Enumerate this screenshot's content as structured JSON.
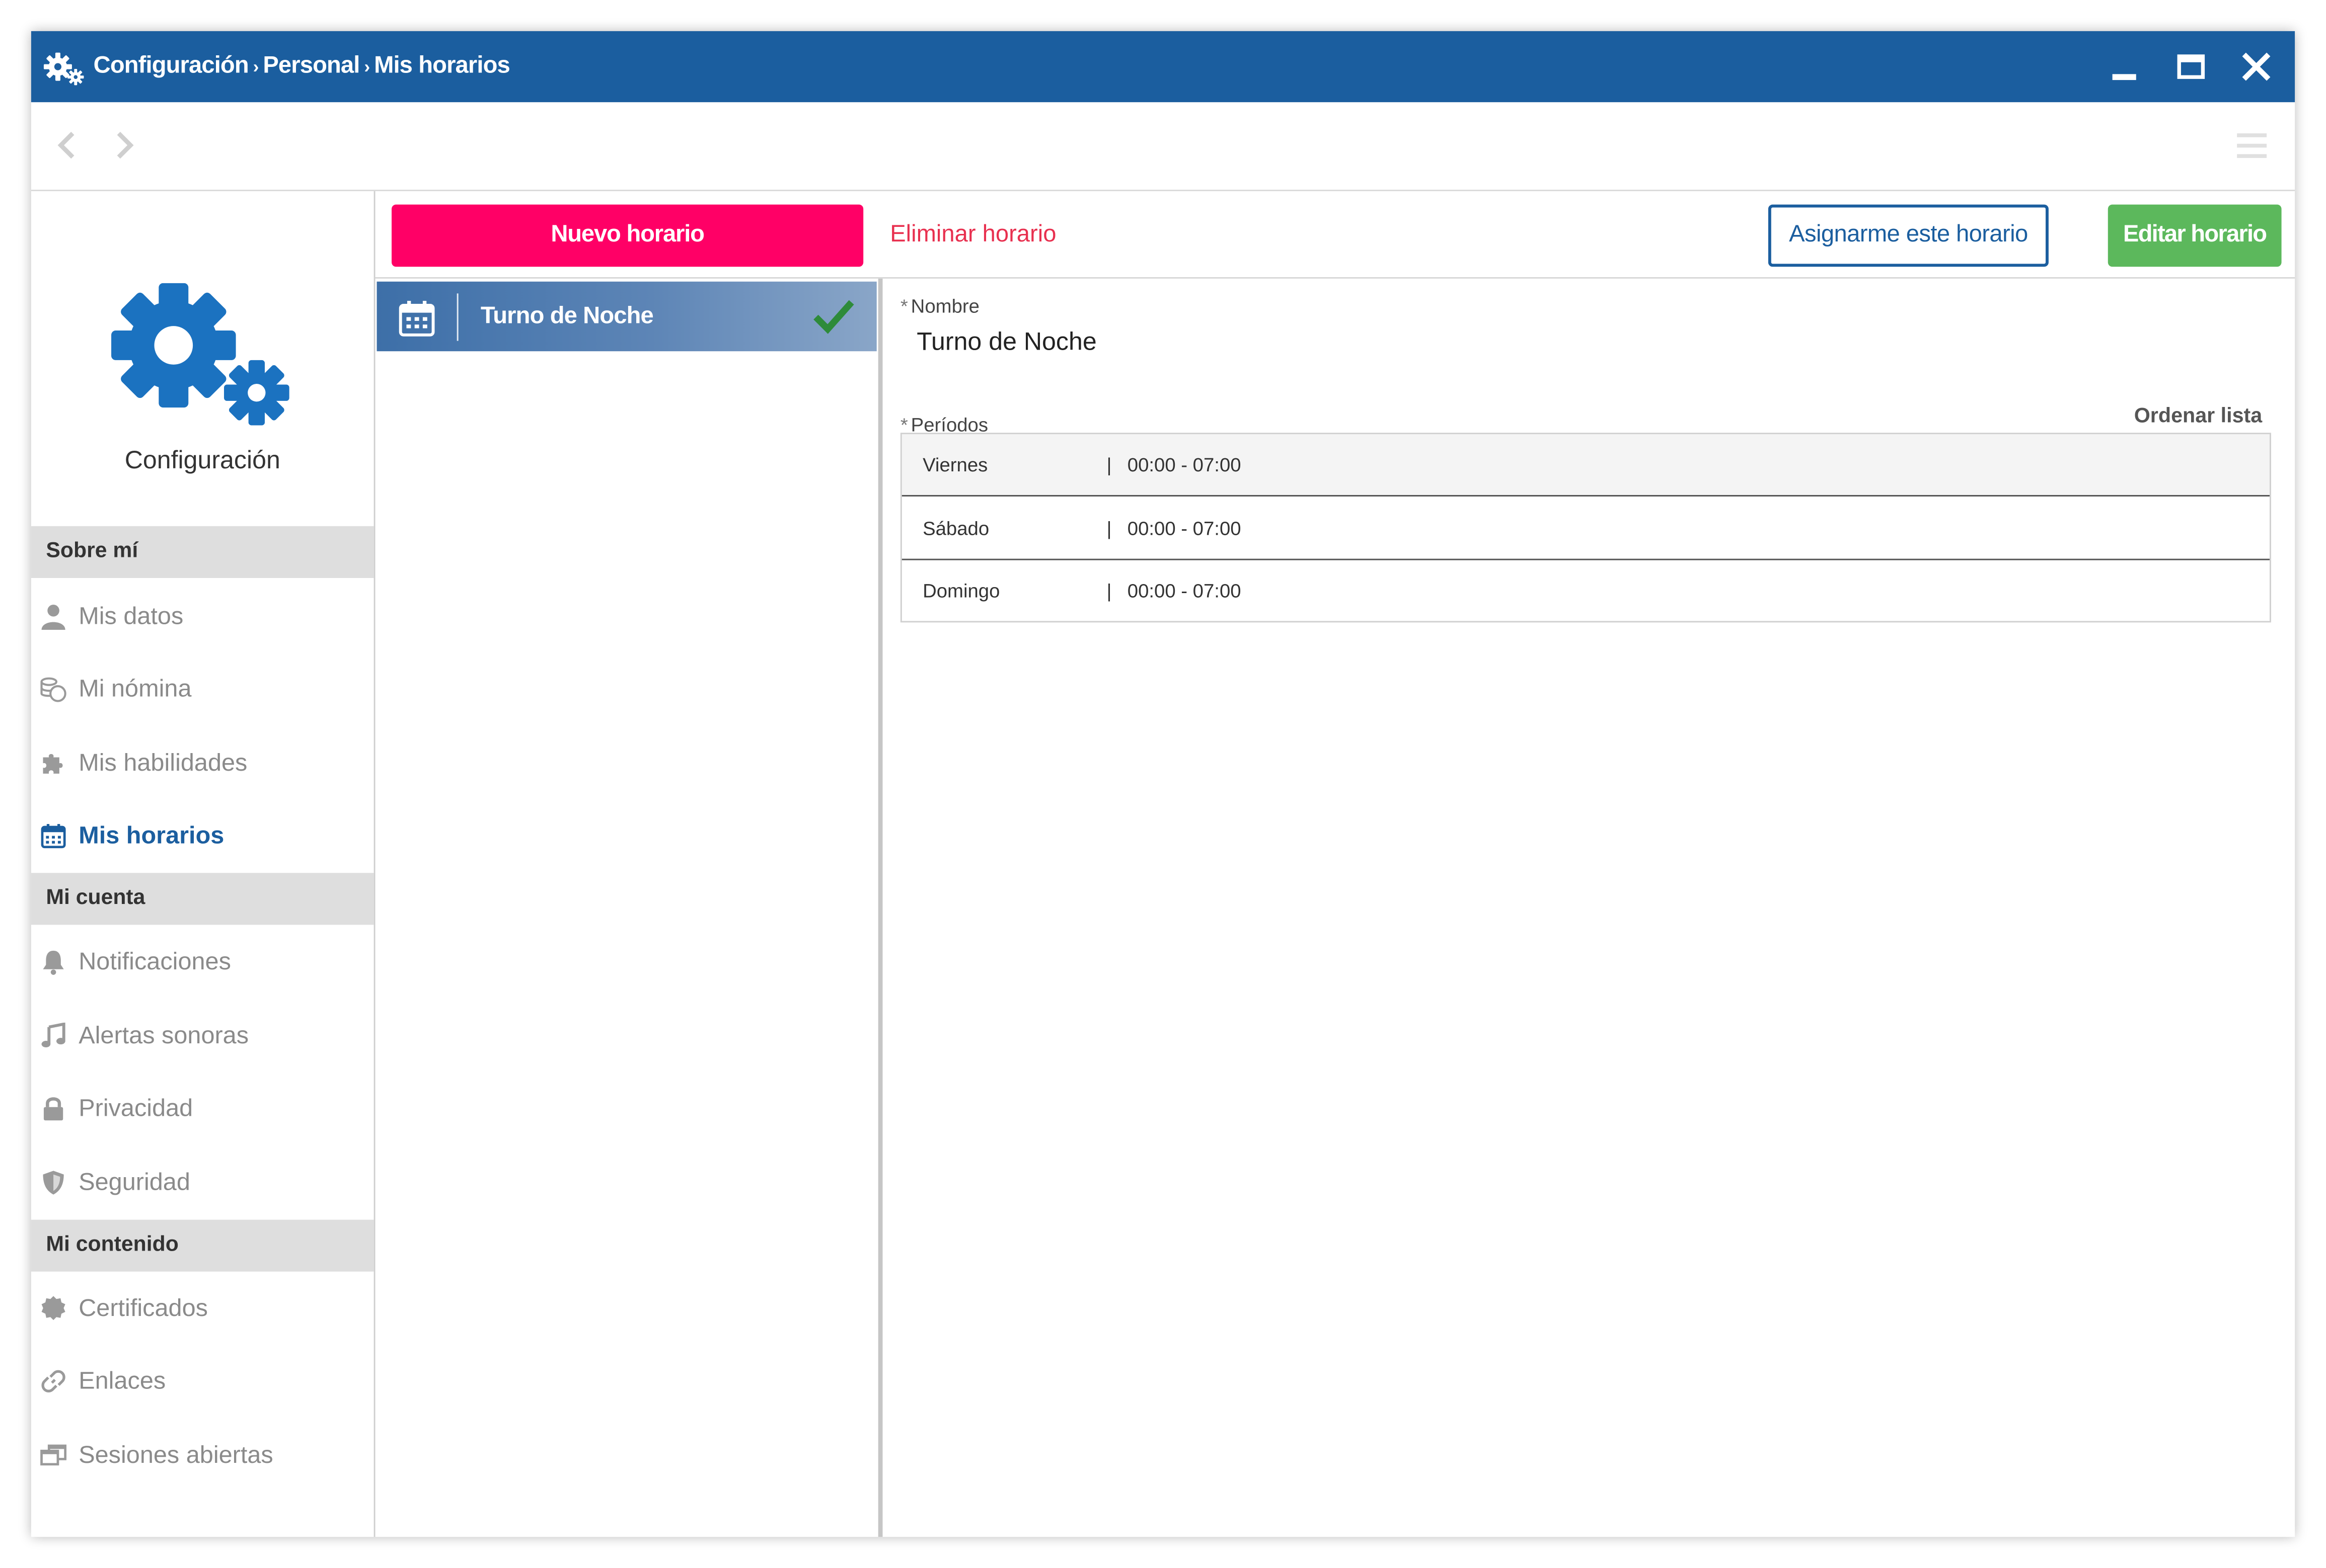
{
  "window": {
    "breadcrumb": [
      "Configuración",
      "Personal",
      "Mis horarios"
    ],
    "breadcrumb_separator": "›",
    "controls": [
      "minimize-icon",
      "maximize-icon",
      "close-icon"
    ],
    "title_bar_color": "#1b5e9f"
  },
  "navbar": {
    "back_icon": "chevron-left-icon",
    "forward_icon": "chevron-right-icon",
    "menu_icon": "hamburger-menu-icon"
  },
  "sidebar": {
    "brand_label": "Configuración",
    "brand_icon": "gears-icon",
    "sections": [
      {
        "title": "Sobre mí",
        "items": [
          {
            "label": "Mis datos",
            "icon": "user-icon"
          },
          {
            "label": "Mi nómina",
            "icon": "coins-icon"
          },
          {
            "label": "Mis habilidades",
            "icon": "puzzle-icon"
          },
          {
            "label": "Mis horarios",
            "icon": "calendar-icon",
            "active": true
          }
        ]
      },
      {
        "title": "Mi cuenta",
        "items": [
          {
            "label": "Notificaciones",
            "icon": "bell-icon"
          },
          {
            "label": "Alertas sonoras",
            "icon": "music-note-icon"
          },
          {
            "label": "Privacidad",
            "icon": "lock-icon"
          },
          {
            "label": "Seguridad",
            "icon": "shield-icon"
          }
        ]
      },
      {
        "title": "Mi contenido",
        "items": [
          {
            "label": "Certificados",
            "icon": "certificate-icon"
          },
          {
            "label": "Enlaces",
            "icon": "link-icon"
          },
          {
            "label": "Sesiones abiertas",
            "icon": "windows-icon"
          }
        ]
      }
    ]
  },
  "toolbar": {
    "new_label": "Nuevo horario",
    "delete_label": "Eliminar horario",
    "assign_label": "Asignarme este horario",
    "edit_label": "Editar horario",
    "colors": {
      "new": "#ff0066",
      "delete": "#e8304f",
      "assign": "#1b5e9f",
      "edit": "#5cb85c"
    }
  },
  "schedules": [
    {
      "name": "Turno de Noche",
      "selected": true,
      "icon": "calendar-icon",
      "status_icon": "check-icon"
    }
  ],
  "detail": {
    "required_mark": "*",
    "name_label": "Nombre",
    "name_value": "Turno de Noche",
    "periods_label": "Períodos",
    "sort_label": "Ordenar lista",
    "period_separator": "|",
    "periods": [
      {
        "day": "Viernes",
        "time": "00:00 - 07:00"
      },
      {
        "day": "Sábado",
        "time": "00:00 - 07:00"
      },
      {
        "day": "Domingo",
        "time": "00:00 - 07:00"
      }
    ]
  }
}
